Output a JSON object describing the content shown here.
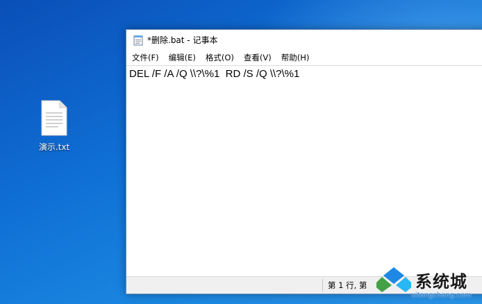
{
  "desktop": {
    "icons": [
      {
        "label": "演示.txt",
        "icon": "text-file-icon"
      }
    ],
    "background_color": "#1a78d8"
  },
  "window": {
    "title": "*删除.bat - 记事本",
    "icon": "notepad-icon",
    "menu": [
      {
        "label": "文件(F)"
      },
      {
        "label": "编辑(E)"
      },
      {
        "label": "格式(O)"
      },
      {
        "label": "查看(V)"
      },
      {
        "label": "帮助(H)"
      }
    ],
    "content": "DEL /F /A /Q \\\\?\\%1  RD /S /Q \\\\?\\%1",
    "status": {
      "position": "第 1 行, 第"
    }
  },
  "watermark": {
    "title": "系统城",
    "url": "xitongcheng.com",
    "colors": [
      "#1e88e5",
      "#43a047",
      "#29b6f6"
    ]
  }
}
